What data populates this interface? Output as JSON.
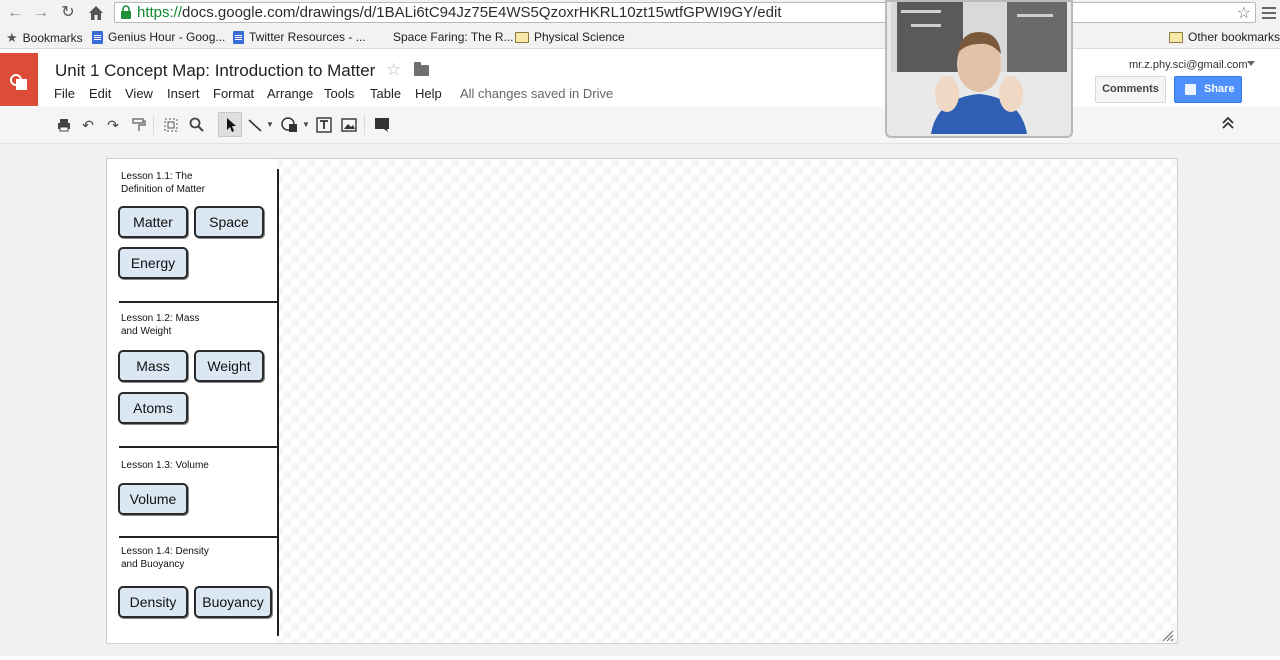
{
  "browser": {
    "url_protocol": "https://",
    "url_rest": "docs.google.com/drawings/d/1BALi6tC94Jz75E4WS5QzoxrHKRL10zt15wtfGPWI9GY/edit",
    "bookmarks": [
      {
        "label": "Bookmarks",
        "icon": "star-icon"
      },
      {
        "label": "Genius Hour - Goog...",
        "icon": "doc-icon"
      },
      {
        "label": "Twitter Resources - ...",
        "icon": "doc-icon"
      },
      {
        "label": "Space Faring: The R...",
        "icon": "none"
      },
      {
        "label": "Physical Science",
        "icon": "folder-icon"
      }
    ],
    "other_bookmarks": "Other bookmarks"
  },
  "docs": {
    "title": "Unit 1 Concept Map: Introduction to Matter",
    "menu": [
      "File",
      "Edit",
      "View",
      "Insert",
      "Format",
      "Arrange",
      "Tools",
      "Table",
      "Help"
    ],
    "save_status": "All changes saved in Drive",
    "user_email": "mr.z.phy.sci@gmail.com",
    "comments_label": "Comments",
    "share_label": "Share",
    "accent_color": "#4d90fe",
    "logo_color": "#dd4b39"
  },
  "canvas": {
    "lessons": [
      {
        "title_line1": "Lesson 1.1: The",
        "title_line2": "Definition of Matter",
        "concepts": [
          "Matter",
          "Space",
          "Energy"
        ]
      },
      {
        "title_line1": "Lesson 1.2: Mass",
        "title_line2": "and Weight",
        "concepts": [
          "Mass",
          "Weight",
          "Atoms"
        ]
      },
      {
        "title_line1": "Lesson 1.3: Volume",
        "title_line2": "",
        "concepts": [
          "Volume"
        ]
      },
      {
        "title_line1": "Lesson 1.4: Density",
        "title_line2": "and Buoyancy",
        "concepts": [
          "Density",
          "Buoyancy"
        ]
      }
    ],
    "concept_fill": "#dbe8f4"
  }
}
